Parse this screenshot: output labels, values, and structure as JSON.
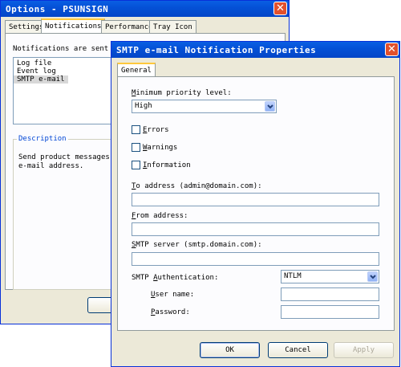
{
  "back_window": {
    "title": "Options - PSUNSIGN",
    "tabs": [
      "Settings",
      "Notifications",
      "Performance",
      "Tray Icon"
    ],
    "active_tab": "Notifications",
    "list_label": "Notifications are sent to",
    "list_items": [
      "Log file",
      "Event log",
      "SMTP e-mail"
    ],
    "selected_item": "SMTP e-mail",
    "description_title": "Description",
    "description_text_1": "Send product messages (em",
    "description_text_2": "e-mail address."
  },
  "dialog": {
    "title": "SMTP e-mail Notification Properties",
    "tab": "General",
    "min_priority_label": "Minimum priority level:",
    "min_priority_value": "High",
    "checkboxes": [
      {
        "label": "Errors",
        "checked": false
      },
      {
        "label": "Warnings",
        "checked": false
      },
      {
        "label": "Information",
        "checked": false
      }
    ],
    "to_label": "To address (admin@domain.com):",
    "to_value": "",
    "from_label": "From address:",
    "from_value": "",
    "server_label": "SMTP server (smtp.domain.com):",
    "server_value": "",
    "auth_label": "SMTP Authentication:",
    "auth_value": "NTLM",
    "username_label": "User name:",
    "username_value": "",
    "password_label": "Password:",
    "password_value": "",
    "ok_label": "OK",
    "cancel_label": "Cancel",
    "apply_label": "Apply"
  }
}
